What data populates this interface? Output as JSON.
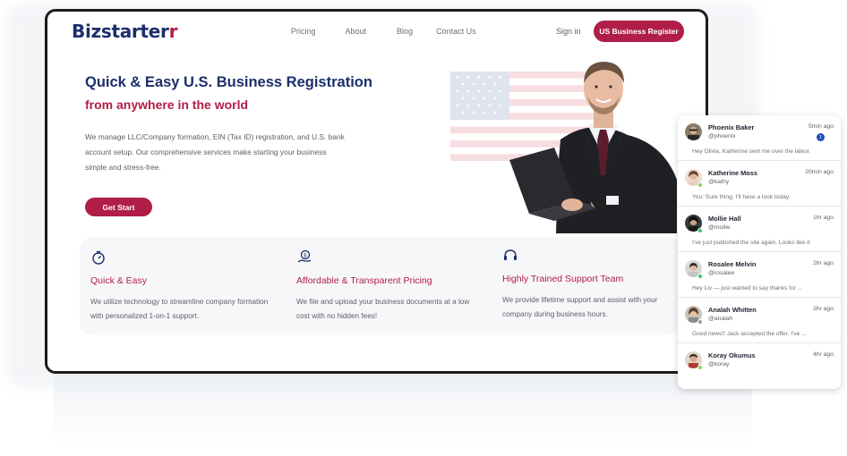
{
  "nav": {
    "logo_main": "Bizstarter",
    "logo_accent": "r",
    "links": [
      "Pricing",
      "About",
      "Blog",
      "Contact Us"
    ],
    "sign_in": "Sign in",
    "cta": "US Business Register"
  },
  "hero": {
    "title": "Quick & Easy U.S. Business Registration",
    "subtitle": "from anywhere in the world",
    "description": "We manage LLC/Company formation, EIN (Tax ID) registration, and U.S. bank account setup. Our comprehensive services make starting your business simple and stress-free.",
    "button": "Get Start"
  },
  "features": [
    {
      "icon": "stopwatch-icon",
      "title": "Quick & Easy",
      "desc": "We utilize technology to streamline company formation with personalized 1-on-1 support."
    },
    {
      "icon": "coin-hand-icon",
      "title": "Affordable & Transparent Pricing",
      "desc": "We file and upload your business documents at a low cost with no hidden fees!"
    },
    {
      "icon": "headset-icon",
      "title": "Highly Trained Support Team",
      "desc": "We provide lifetime support and assist with your company during business hours."
    }
  ],
  "chats": [
    {
      "name": "Phoenix Baker",
      "handle": "@phoenix",
      "time": "5min ago",
      "message": "Hey Olivia, Katherine sent me over the latest",
      "unread": "1",
      "online": ""
    },
    {
      "name": "Katherine Moss",
      "handle": "@kathy",
      "time": "20min ago",
      "message": "You: Sure thing, I'll have a look today.",
      "unread": "",
      "online": "#7ed957"
    },
    {
      "name": "Mollie Hall",
      "handle": "@mollie",
      "time": "1hr ago",
      "message": "I've just published the site again. Looks like it",
      "unread": "",
      "online": "#2ecc71"
    },
    {
      "name": "Rosalee Melvin",
      "handle": "@rosalee",
      "time": "2hr ago",
      "message": "Hey Liv — just wanted to say thanks for ...",
      "unread": "",
      "online": "#2ecc71"
    },
    {
      "name": "Analah Whitten",
      "handle": "@analah",
      "time": "2hr ago",
      "message": "Good news!! Jack accepted the offer. I've ...",
      "unread": "",
      "online": "#9aa0a6"
    },
    {
      "name": "Koray Okumus",
      "handle": "@koray",
      "time": "4hr ago",
      "message": "",
      "unread": "",
      "online": "#7ed957"
    }
  ],
  "colors": {
    "brand_navy": "#1b2f6b",
    "brand_red": "#b01e47"
  }
}
